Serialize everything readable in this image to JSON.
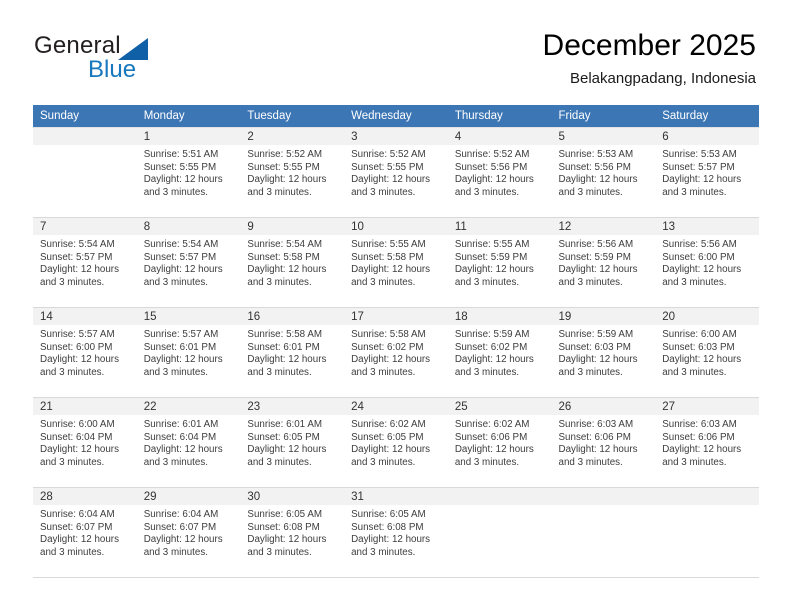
{
  "brand": {
    "name_top": "General",
    "name_bottom": "Blue",
    "accent_color": "#1878be",
    "triangle_color": "#1060a8"
  },
  "header": {
    "title": "December 2025",
    "subtitle": "Belakangpadang, Indonesia"
  },
  "theme": {
    "header_row_bg": "#3c76b5",
    "daynum_bg": "#f2f2f2",
    "cell_bg": "#ffffff",
    "grid_line": "#d9d9d9",
    "text_color": "#3d3d3d"
  },
  "weekday_headers": [
    "Sunday",
    "Monday",
    "Tuesday",
    "Wednesday",
    "Thursday",
    "Friday",
    "Saturday"
  ],
  "weeks": [
    [
      {
        "day": "",
        "sunrise": "",
        "sunset": "",
        "daylight_line1": "",
        "daylight_line2": "",
        "blank": true
      },
      {
        "day": "1",
        "sunrise": "Sunrise: 5:51 AM",
        "sunset": "Sunset: 5:55 PM",
        "daylight_line1": "Daylight: 12 hours",
        "daylight_line2": "and 3 minutes."
      },
      {
        "day": "2",
        "sunrise": "Sunrise: 5:52 AM",
        "sunset": "Sunset: 5:55 PM",
        "daylight_line1": "Daylight: 12 hours",
        "daylight_line2": "and 3 minutes."
      },
      {
        "day": "3",
        "sunrise": "Sunrise: 5:52 AM",
        "sunset": "Sunset: 5:55 PM",
        "daylight_line1": "Daylight: 12 hours",
        "daylight_line2": "and 3 minutes."
      },
      {
        "day": "4",
        "sunrise": "Sunrise: 5:52 AM",
        "sunset": "Sunset: 5:56 PM",
        "daylight_line1": "Daylight: 12 hours",
        "daylight_line2": "and 3 minutes."
      },
      {
        "day": "5",
        "sunrise": "Sunrise: 5:53 AM",
        "sunset": "Sunset: 5:56 PM",
        "daylight_line1": "Daylight: 12 hours",
        "daylight_line2": "and 3 minutes."
      },
      {
        "day": "6",
        "sunrise": "Sunrise: 5:53 AM",
        "sunset": "Sunset: 5:57 PM",
        "daylight_line1": "Daylight: 12 hours",
        "daylight_line2": "and 3 minutes."
      }
    ],
    [
      {
        "day": "7",
        "sunrise": "Sunrise: 5:54 AM",
        "sunset": "Sunset: 5:57 PM",
        "daylight_line1": "Daylight: 12 hours",
        "daylight_line2": "and 3 minutes."
      },
      {
        "day": "8",
        "sunrise": "Sunrise: 5:54 AM",
        "sunset": "Sunset: 5:57 PM",
        "daylight_line1": "Daylight: 12 hours",
        "daylight_line2": "and 3 minutes."
      },
      {
        "day": "9",
        "sunrise": "Sunrise: 5:54 AM",
        "sunset": "Sunset: 5:58 PM",
        "daylight_line1": "Daylight: 12 hours",
        "daylight_line2": "and 3 minutes."
      },
      {
        "day": "10",
        "sunrise": "Sunrise: 5:55 AM",
        "sunset": "Sunset: 5:58 PM",
        "daylight_line1": "Daylight: 12 hours",
        "daylight_line2": "and 3 minutes."
      },
      {
        "day": "11",
        "sunrise": "Sunrise: 5:55 AM",
        "sunset": "Sunset: 5:59 PM",
        "daylight_line1": "Daylight: 12 hours",
        "daylight_line2": "and 3 minutes."
      },
      {
        "day": "12",
        "sunrise": "Sunrise: 5:56 AM",
        "sunset": "Sunset: 5:59 PM",
        "daylight_line1": "Daylight: 12 hours",
        "daylight_line2": "and 3 minutes."
      },
      {
        "day": "13",
        "sunrise": "Sunrise: 5:56 AM",
        "sunset": "Sunset: 6:00 PM",
        "daylight_line1": "Daylight: 12 hours",
        "daylight_line2": "and 3 minutes."
      }
    ],
    [
      {
        "day": "14",
        "sunrise": "Sunrise: 5:57 AM",
        "sunset": "Sunset: 6:00 PM",
        "daylight_line1": "Daylight: 12 hours",
        "daylight_line2": "and 3 minutes."
      },
      {
        "day": "15",
        "sunrise": "Sunrise: 5:57 AM",
        "sunset": "Sunset: 6:01 PM",
        "daylight_line1": "Daylight: 12 hours",
        "daylight_line2": "and 3 minutes."
      },
      {
        "day": "16",
        "sunrise": "Sunrise: 5:58 AM",
        "sunset": "Sunset: 6:01 PM",
        "daylight_line1": "Daylight: 12 hours",
        "daylight_line2": "and 3 minutes."
      },
      {
        "day": "17",
        "sunrise": "Sunrise: 5:58 AM",
        "sunset": "Sunset: 6:02 PM",
        "daylight_line1": "Daylight: 12 hours",
        "daylight_line2": "and 3 minutes."
      },
      {
        "day": "18",
        "sunrise": "Sunrise: 5:59 AM",
        "sunset": "Sunset: 6:02 PM",
        "daylight_line1": "Daylight: 12 hours",
        "daylight_line2": "and 3 minutes."
      },
      {
        "day": "19",
        "sunrise": "Sunrise: 5:59 AM",
        "sunset": "Sunset: 6:03 PM",
        "daylight_line1": "Daylight: 12 hours",
        "daylight_line2": "and 3 minutes."
      },
      {
        "day": "20",
        "sunrise": "Sunrise: 6:00 AM",
        "sunset": "Sunset: 6:03 PM",
        "daylight_line1": "Daylight: 12 hours",
        "daylight_line2": "and 3 minutes."
      }
    ],
    [
      {
        "day": "21",
        "sunrise": "Sunrise: 6:00 AM",
        "sunset": "Sunset: 6:04 PM",
        "daylight_line1": "Daylight: 12 hours",
        "daylight_line2": "and 3 minutes."
      },
      {
        "day": "22",
        "sunrise": "Sunrise: 6:01 AM",
        "sunset": "Sunset: 6:04 PM",
        "daylight_line1": "Daylight: 12 hours",
        "daylight_line2": "and 3 minutes."
      },
      {
        "day": "23",
        "sunrise": "Sunrise: 6:01 AM",
        "sunset": "Sunset: 6:05 PM",
        "daylight_line1": "Daylight: 12 hours",
        "daylight_line2": "and 3 minutes."
      },
      {
        "day": "24",
        "sunrise": "Sunrise: 6:02 AM",
        "sunset": "Sunset: 6:05 PM",
        "daylight_line1": "Daylight: 12 hours",
        "daylight_line2": "and 3 minutes."
      },
      {
        "day": "25",
        "sunrise": "Sunrise: 6:02 AM",
        "sunset": "Sunset: 6:06 PM",
        "daylight_line1": "Daylight: 12 hours",
        "daylight_line2": "and 3 minutes."
      },
      {
        "day": "26",
        "sunrise": "Sunrise: 6:03 AM",
        "sunset": "Sunset: 6:06 PM",
        "daylight_line1": "Daylight: 12 hours",
        "daylight_line2": "and 3 minutes."
      },
      {
        "day": "27",
        "sunrise": "Sunrise: 6:03 AM",
        "sunset": "Sunset: 6:06 PM",
        "daylight_line1": "Daylight: 12 hours",
        "daylight_line2": "and 3 minutes."
      }
    ],
    [
      {
        "day": "28",
        "sunrise": "Sunrise: 6:04 AM",
        "sunset": "Sunset: 6:07 PM",
        "daylight_line1": "Daylight: 12 hours",
        "daylight_line2": "and 3 minutes."
      },
      {
        "day": "29",
        "sunrise": "Sunrise: 6:04 AM",
        "sunset": "Sunset: 6:07 PM",
        "daylight_line1": "Daylight: 12 hours",
        "daylight_line2": "and 3 minutes."
      },
      {
        "day": "30",
        "sunrise": "Sunrise: 6:05 AM",
        "sunset": "Sunset: 6:08 PM",
        "daylight_line1": "Daylight: 12 hours",
        "daylight_line2": "and 3 minutes."
      },
      {
        "day": "31",
        "sunrise": "Sunrise: 6:05 AM",
        "sunset": "Sunset: 6:08 PM",
        "daylight_line1": "Daylight: 12 hours",
        "daylight_line2": "and 3 minutes."
      },
      {
        "day": "",
        "sunrise": "",
        "sunset": "",
        "daylight_line1": "",
        "daylight_line2": "",
        "blank": true
      },
      {
        "day": "",
        "sunrise": "",
        "sunset": "",
        "daylight_line1": "",
        "daylight_line2": "",
        "blank": true
      },
      {
        "day": "",
        "sunrise": "",
        "sunset": "",
        "daylight_line1": "",
        "daylight_line2": "",
        "blank": true
      }
    ]
  ]
}
